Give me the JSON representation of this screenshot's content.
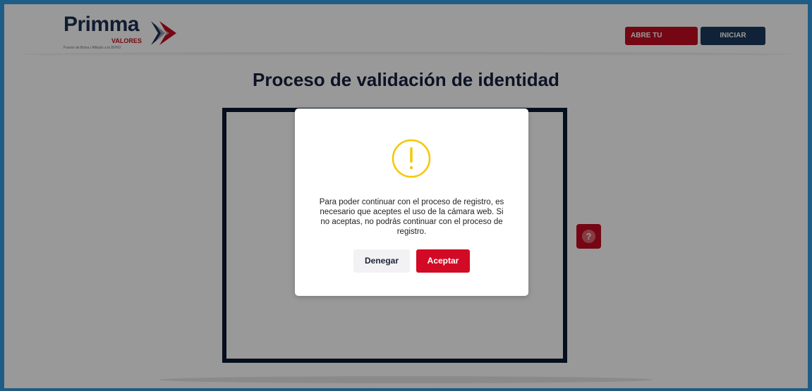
{
  "header": {
    "logo_text": "Primma",
    "logo_sub": "VALORES",
    "logo_tagline": "Puesto de Bolsa | Afiliado a la BVRD",
    "open_account_label": "ABRE TU CUENTA",
    "login_label": "INICIAR SESIÓN"
  },
  "main": {
    "title": "Proceso de validación de identidad",
    "help_glyph": "?"
  },
  "modal": {
    "icon": "warning-icon",
    "icon_glyph": "!",
    "message": "Para poder continuar con el proceso de registro, es necesario que aceptes el uso de la cámara web. Si no aceptas, no podrás continuar con el proceso de registro.",
    "deny_label": "Denegar",
    "accept_label": "Aceptar"
  },
  "colors": {
    "brand_red": "#c40d22",
    "brand_navy": "#1b2f52",
    "warning_yellow": "#f7c600",
    "frame_blue": "#1f5c86"
  }
}
